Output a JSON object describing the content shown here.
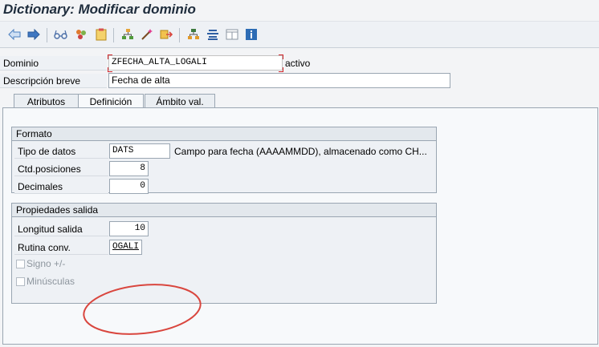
{
  "window": {
    "title": "Dictionary: Modificar dominio"
  },
  "toolbar": {
    "icons": [
      "back-arrow-icon",
      "forward-arrow-icon",
      "glasses-icon",
      "activate-icon",
      "clipboard-icon",
      "hierarchy-icon",
      "wand-icon",
      "navigate-icon",
      "object-list-icon",
      "list-icon",
      "window-icon",
      "info-icon"
    ]
  },
  "header": {
    "dominio_label": "Dominio",
    "dominio_value": "ZFECHA_ALTA_LOGALI",
    "status": "activo",
    "descripcion_label": "Descripción breve",
    "descripcion_value": "Fecha de alta"
  },
  "tabs": [
    {
      "label": "Atributos",
      "active": false
    },
    {
      "label": "Definición",
      "active": true
    },
    {
      "label": "Ámbito val.",
      "active": false
    }
  ],
  "formato": {
    "title": "Formato",
    "tipo_label": "Tipo de datos",
    "tipo_value": "DATS",
    "tipo_desc": "Campo para fecha (AAAAMMDD), almacenado como CH...",
    "posiciones_label": "Ctd.posiciones",
    "posiciones_value": "8",
    "decimales_label": "Decimales",
    "decimales_value": "0"
  },
  "propiedades": {
    "title": "Propiedades salida",
    "longitud_label": "Longitud salida",
    "longitud_value": "10",
    "rutina_label": "Rutina conv.",
    "rutina_value": "OGALI",
    "signo_label": "Signo +/-",
    "minusculas_label": "Minúsculas"
  },
  "annotation": {
    "color": "#d9463e"
  },
  "colors": {
    "required_marker": "#d2262b",
    "title": "#1f2d3d"
  }
}
